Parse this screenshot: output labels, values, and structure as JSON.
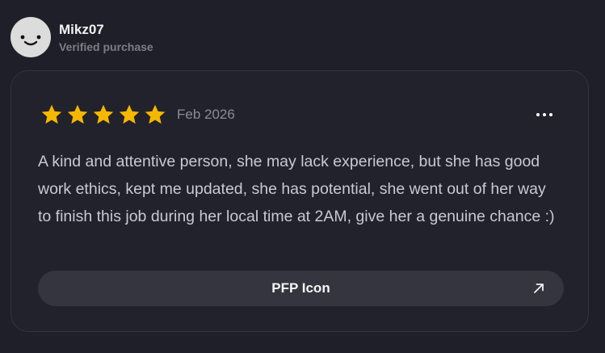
{
  "reviewer": {
    "name": "Mikz07",
    "subtitle": "Verified purchase",
    "avatar_icon": "smiley-face-icon"
  },
  "review": {
    "rating": 5,
    "rating_max": 5,
    "star_color": "#f5b800",
    "date": "Feb 2026",
    "text": "A kind and attentive person, she may lack experience, but she has good work ethics, kept me updated, she has potential, she went out of her way to finish this job during her local time at 2AM, give her a genuine chance :)",
    "more_icon": "more-horizontal-icon"
  },
  "product_link": {
    "label": "PFP Icon",
    "icon": "arrow-up-right-icon"
  }
}
